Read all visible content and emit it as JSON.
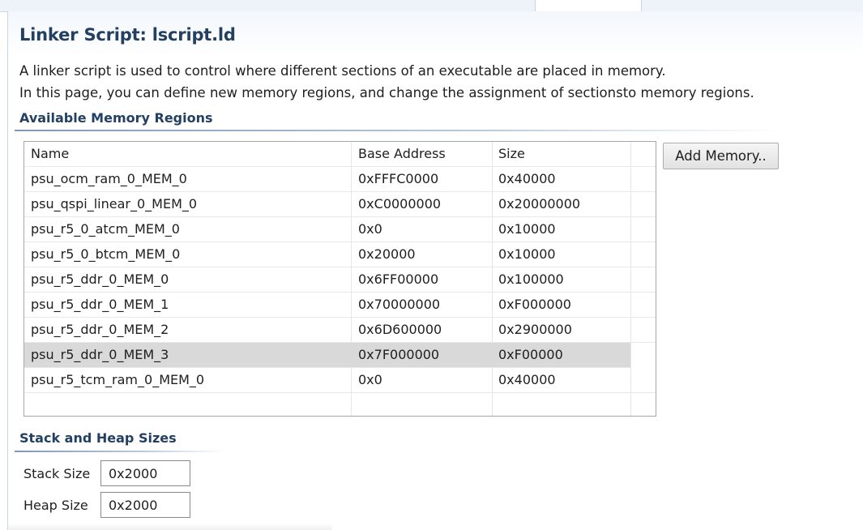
{
  "header": {
    "title": "Linker Script: lscript.ld"
  },
  "description": {
    "line1": "A linker script is used to control where different sections of an executable are placed in memory.",
    "line2": "In this page, you can define new memory regions, and change the assignment of sectionsto memory regions."
  },
  "memory_regions": {
    "section_title": "Available Memory Regions",
    "columns": [
      "Name",
      "Base Address",
      "Size"
    ],
    "rows": [
      {
        "name": "psu_ocm_ram_0_MEM_0",
        "base": "0xFFFC0000",
        "size": "0x40000"
      },
      {
        "name": "psu_qspi_linear_0_MEM_0",
        "base": "0xC0000000",
        "size": "0x20000000"
      },
      {
        "name": "psu_r5_0_atcm_MEM_0",
        "base": "0x0",
        "size": "0x10000"
      },
      {
        "name": "psu_r5_0_btcm_MEM_0",
        "base": "0x20000",
        "size": "0x10000"
      },
      {
        "name": "psu_r5_ddr_0_MEM_0",
        "base": "0x6FF00000",
        "size": "0x100000"
      },
      {
        "name": "psu_r5_ddr_0_MEM_1",
        "base": "0x70000000",
        "size": "0xF000000"
      },
      {
        "name": "psu_r5_ddr_0_MEM_2",
        "base": "0x6D600000",
        "size": "0x2900000"
      },
      {
        "name": "psu_r5_ddr_0_MEM_3",
        "base": "0x7F000000",
        "size": "0xF00000"
      },
      {
        "name": "psu_r5_tcm_ram_0_MEM_0",
        "base": "0x0",
        "size": "0x40000"
      }
    ],
    "selected_row": "psu_r5_ddr_0_MEM_3",
    "add_button_label": "Add Memory.."
  },
  "stack_heap": {
    "section_title": "Stack and Heap Sizes",
    "stack_label": "Stack Size",
    "stack_value": "0x2000",
    "heap_label": "Heap Size",
    "heap_value": "0x2000"
  },
  "colors": {
    "title": "#233f61",
    "selected_row": "#d9d9d9",
    "header_tint": "#f3f7fc"
  }
}
